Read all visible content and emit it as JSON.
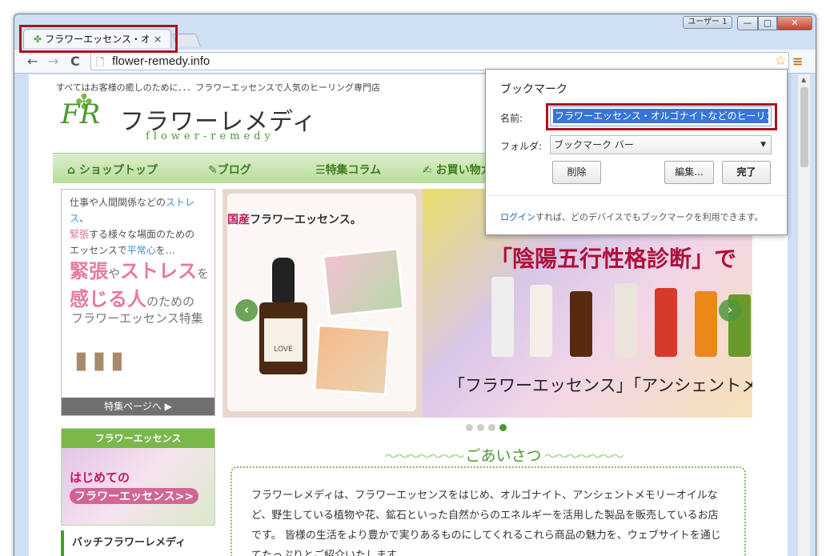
{
  "window": {
    "user_button": "ユーザー 1",
    "minimize": "—",
    "maximize": "▢",
    "close": "✕"
  },
  "tab": {
    "title": "フラワーエッセンス・オルゴナイトなどのヒーリング",
    "close": "×"
  },
  "toolbar": {
    "back": "←",
    "forward": "→",
    "reload": "C",
    "url": "flower-remedy.info",
    "star": "☆",
    "menu": "≡"
  },
  "site": {
    "tagline": "すべてはお客様の癒しのために．．．フラワーエッセンスで人気のヒーリング専門店",
    "logo_mark": "FR",
    "logo_jp": "フラワーレメディ",
    "logo_en": "flower-remedy",
    "nav": [
      {
        "icon": "home-icon",
        "label": "ショップトップ"
      },
      {
        "icon": "pencil-icon",
        "label": "ブログ"
      },
      {
        "icon": "list-icon",
        "label": "特集コラム"
      },
      {
        "icon": "edit-icon",
        "label": "お買い物ガイド"
      }
    ],
    "side_banner": {
      "lead_1": "仕事や人間関係などの",
      "lead_2": "ストレス",
      "lead_3": "、",
      "lead_4": "緊張",
      "lead_5": "する様々な場面のための",
      "lead_6": "エッセンスで",
      "lead_7": "平常心",
      "lead_8": "を…",
      "head_1": "緊張",
      "head_2": "や",
      "head_3": "ストレス",
      "head_4": "を",
      "head_5": "感じる人",
      "head_6": "のための",
      "sub": "フラワーエッセンス特集",
      "link": "特集ページへ ▶"
    },
    "slide_left": {
      "title_prefix": "国産",
      "title_rest": "フラワーエッセンス。",
      "bottle_label": "LOVE"
    },
    "slide_right": {
      "title": "「陰陽五行性格診断」で",
      "sub": "「フラワーエッセンス」「アンシェントメ"
    },
    "slider_prev": "‹",
    "slider_next": "›",
    "side_box": {
      "header": "フラワーエッセンス",
      "line_1": "はじめての",
      "line_2": "フラワーエッセンス>>"
    },
    "side_item": "バッチフラワーレメディ",
    "greeting": {
      "title": "ごあいさつ",
      "text": "フラワーレメディは、フラワーエッセンスをはじめ、オルゴナイト、アンシェントメモリーオイルなど、野生している植物や花、鉱石といった自然からのエネルギーを活用した製品を販売しているお店です。 皆様の生活をより豊かで実りあるものにしてくれるこれら商品の魅力を、ウェブサイトを通じてたっぷりとご紹介いたします。"
    }
  },
  "bookmark_bubble": {
    "title": "ブックマーク",
    "name_label": "名前:",
    "name_value": "フラワーエッセンス・オルゴナイトなどのヒーリング",
    "folder_label": "フォルダ:",
    "folder_value": "ブックマーク バー",
    "delete": "削除",
    "edit": "編集...",
    "done": "完了",
    "footer_link": "ログイン",
    "footer_text": "すれば、どのデバイスでもブックマークを利用できます。"
  }
}
